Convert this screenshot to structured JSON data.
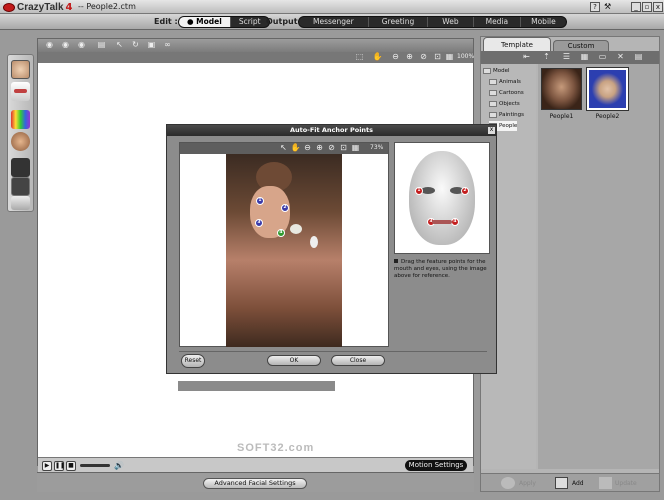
{
  "app": {
    "name": "CrazyTalk",
    "version": "4",
    "filename": "-- People2.ctm"
  },
  "window_buttons": {
    "help": "?",
    "minimize": "_",
    "restore": "▫",
    "close": "x"
  },
  "modebar": {
    "edit_label": "Edit :",
    "edit_modes": [
      "Model",
      "Script"
    ],
    "active_mode": "Model",
    "output_label": "Output :",
    "outputs": [
      "Messenger",
      "Greeting",
      "Web",
      "Media",
      "Mobile"
    ]
  },
  "viewer": {
    "zoom_level": "100%",
    "motion_settings_label": "Motion Settings",
    "advanced_label": "Advanced Facial Settings",
    "watermark": "SOFT32.com"
  },
  "right_panel": {
    "tabs": [
      "Template",
      "Custom"
    ],
    "active_tab": "Template",
    "tree_root": "Model",
    "tree_items": [
      "Animals",
      "Cartoons",
      "Objects",
      "Paintings",
      "People"
    ],
    "selected_item": "People",
    "thumbnails": [
      {
        "label": "People1"
      },
      {
        "label": "People2"
      }
    ],
    "footer": {
      "apply": "Apply",
      "add": "Add",
      "update": "Update"
    }
  },
  "dialog": {
    "title": "Auto-Fit Anchor Points",
    "zoom_level": "73%",
    "instruction": "Drag the feature points for the mouth and eyes, using the image above for reference.",
    "reset_label": "Reset",
    "ok_label": "OK",
    "close_label": "Close",
    "photo_points": [
      "1",
      "2",
      "3",
      "4"
    ],
    "ref_points": [
      "1",
      "2",
      "3",
      "4"
    ]
  },
  "colors": {
    "accent_red": "#c21a1a",
    "anchor_blue": "#3a3aa8",
    "anchor_green": "#2f9a2f",
    "ref_red": "#c41e1e"
  }
}
